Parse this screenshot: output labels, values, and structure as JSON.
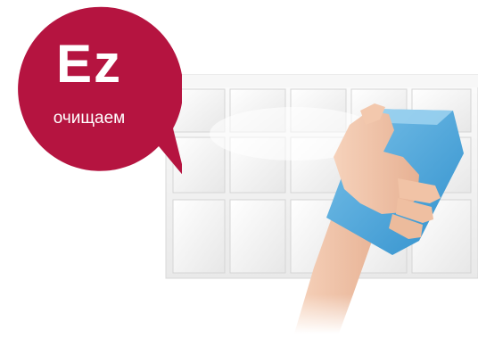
{
  "badge": {
    "title": "Ez",
    "subtitle": "очищаем",
    "color": "#b51440"
  },
  "illustration": {
    "panel_color": "#f2f2f2",
    "sponge_color": "#4aa3d8",
    "skin_color": "#f1c3a6"
  }
}
